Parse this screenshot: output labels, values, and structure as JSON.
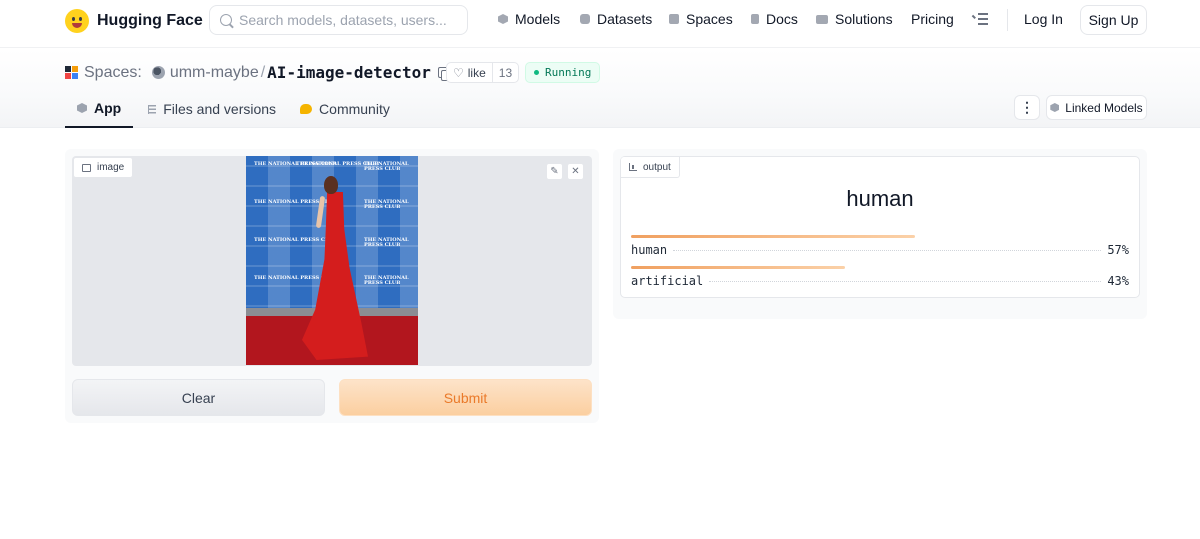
{
  "nav": {
    "brand": "Hugging Face",
    "search_placeholder": "Search models, datasets, users...",
    "links": [
      "Models",
      "Datasets",
      "Spaces",
      "Docs",
      "Solutions",
      "Pricing"
    ],
    "login": "Log In",
    "signup": "Sign Up"
  },
  "space": {
    "section": "Spaces:",
    "user": "umm-maybe",
    "separator": "/",
    "repo": "AI-image-detector",
    "like_label": "like",
    "like_count": "13",
    "status": "Running"
  },
  "tabs": [
    {
      "label": "App",
      "active": true
    },
    {
      "label": "Files and versions",
      "active": false
    },
    {
      "label": "Community",
      "active": false
    }
  ],
  "header_actions": {
    "more": "⋮",
    "linked_models": "Linked Models"
  },
  "input_panel": {
    "label": "image",
    "clear": "Clear",
    "submit": "Submit",
    "photo_text": "THE NATIONAL PRESS CLUB"
  },
  "output_panel": {
    "label": "output",
    "prediction": "human",
    "confidences": [
      {
        "label": "human",
        "value": 0.57,
        "text": "57%"
      },
      {
        "label": "artificial",
        "value": 0.43,
        "text": "43%"
      }
    ]
  },
  "colors": {
    "accent": "#ea7a2a",
    "running": "#10b981"
  }
}
